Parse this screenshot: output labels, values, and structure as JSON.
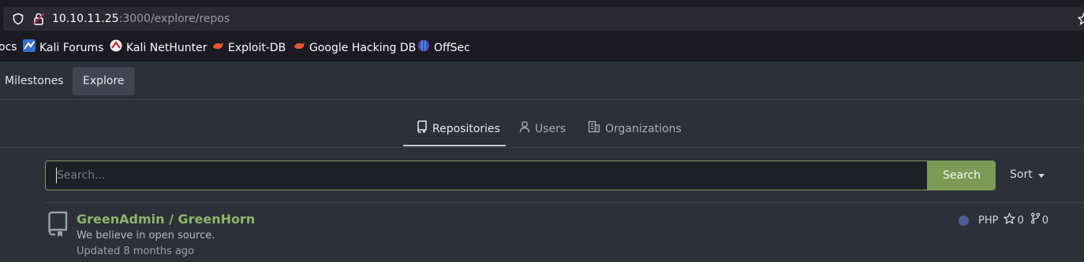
{
  "browser": {
    "url_host": "10.10.11.25",
    "url_path": ":3000/explore/repos",
    "icons": [
      "shield-icon",
      "lock-icon",
      "star-icon"
    ]
  },
  "bookmarks": [
    {
      "label": "ocs",
      "icon": ""
    },
    {
      "label": "Kali Forums",
      "icon": "kali-forums-icon"
    },
    {
      "label": "Kali NetHunter",
      "icon": "kali-nethunter-icon"
    },
    {
      "label": "Exploit-DB",
      "icon": "exploit-db-icon"
    },
    {
      "label": "Google Hacking DB",
      "icon": "google-hacking-db-icon"
    },
    {
      "label": "OffSec",
      "icon": "offsec-icon"
    }
  ],
  "nav": {
    "milestones": "Milestones",
    "explore": "Explore"
  },
  "tabs": {
    "repositories": "Repositories",
    "users": "Users",
    "organizations": "Organizations",
    "active": "repositories"
  },
  "search": {
    "placeholder": "Search...",
    "value": "",
    "button": "Search",
    "sort": "Sort"
  },
  "repo": {
    "owner_repo": "GreenAdmin / GreenHorn",
    "description": "We believe in open source.",
    "updated": "Updated 8 months ago",
    "language": "PHP",
    "language_color": "#4f5d95",
    "stars": "0",
    "forks": "0"
  },
  "colors": {
    "accent": "#7a9a56",
    "link": "#8fb46a",
    "background": "#2b3039"
  }
}
